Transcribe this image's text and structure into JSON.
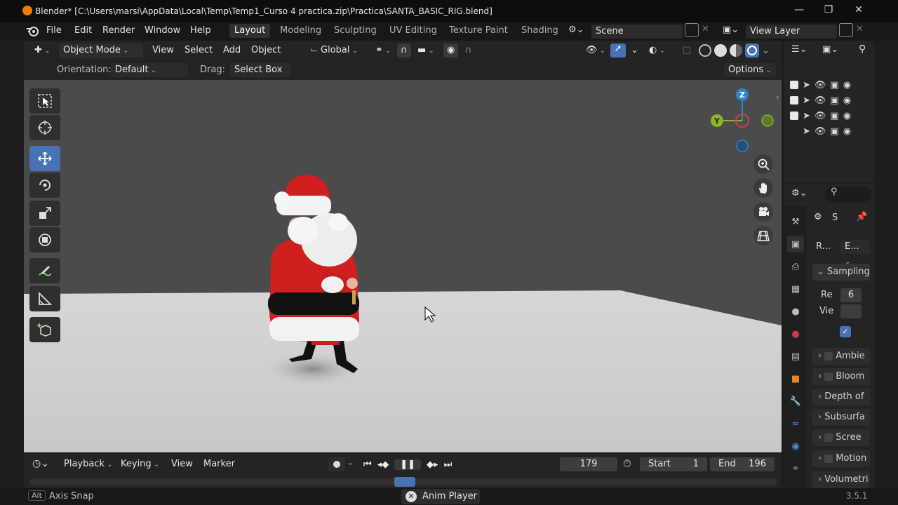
{
  "window": {
    "title": "Blender* [C:\\Users\\marsi\\AppData\\Local\\Temp\\Temp1_Curso 4 practica.zip\\Practica\\SANTA_BASIC_RIG.blend]"
  },
  "menu": [
    "File",
    "Edit",
    "Render",
    "Window",
    "Help"
  ],
  "workspaces": [
    "Layout",
    "Modeling",
    "Sculpting",
    "UV Editing",
    "Texture Paint",
    "Shading"
  ],
  "active_workspace": "Layout",
  "scene": {
    "label": "Scene"
  },
  "view_layer": {
    "label": "View Layer"
  },
  "viewport_header": {
    "mode": "Object Mode",
    "menus": [
      "View",
      "Select",
      "Add",
      "Object"
    ],
    "transform_orientation": "Global"
  },
  "tool_settings": {
    "orientation_label": "Orientation:",
    "orientation_value": "Default",
    "drag_label": "Drag:",
    "drag_value": "Select Box",
    "options": "Options"
  },
  "gizmo": {
    "z": "Z",
    "y": "Y"
  },
  "timeline": {
    "menus": [
      "Playback",
      "Keying",
      "View",
      "Marker"
    ],
    "current_frame": "179",
    "start_label": "Start",
    "start_value": "1",
    "end_label": "End",
    "end_value": "196"
  },
  "status": {
    "key": "Alt",
    "hint": "Axis Snap",
    "notification": "Anim Player",
    "version": "3.5.1"
  },
  "properties": {
    "search_placeholder": "",
    "scene_short": "S",
    "render_short": "R...",
    "engine_short": "E...",
    "sampling": "Sampling",
    "render_label": "Re",
    "render_value": "6",
    "viewport_label": "Vie",
    "panels": [
      "Ambie",
      "Bloom",
      "Depth of",
      "Subsurfa",
      "Scree",
      "Motion",
      "Volumetri"
    ]
  },
  "colors": {
    "accent": "#4772b3",
    "axis_x": "#d1394b",
    "axis_y": "#8ab42c",
    "axis_z": "#2f83cf"
  }
}
